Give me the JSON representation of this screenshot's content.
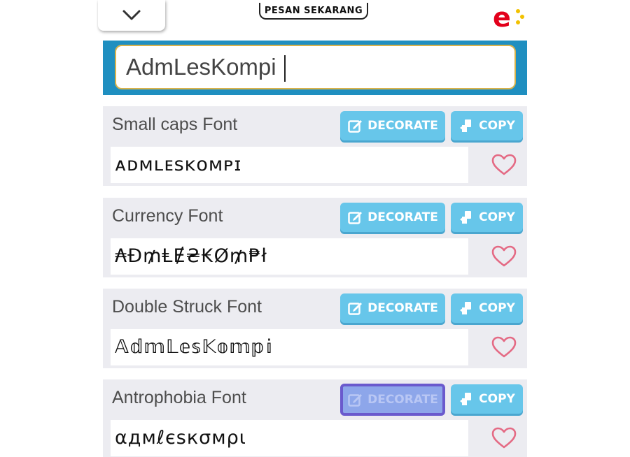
{
  "ad": {
    "button_label": "PESAN SEKARANG",
    "logo_icon": "brand-e-logo"
  },
  "input": {
    "value": "AdmLesKompi"
  },
  "fonts": [
    {
      "name": "Small caps Font",
      "output": "ᴀᴅᴍʟᴇsᴋᴏᴍᴘɪ",
      "decorate_label": "DECORATE",
      "copy_label": "COPY",
      "decorate_active": false
    },
    {
      "name": "Currency Font",
      "output": "₳Đ₥ⱠɆ₴₭Ø₥₱ł",
      "decorate_label": "DECORATE",
      "copy_label": "COPY",
      "decorate_active": false
    },
    {
      "name": "Double Struck Font",
      "output": "𝔸𝕕𝕞𝕃𝕖𝕤𝕂𝕠𝕞𝕡𝕚",
      "decorate_label": "DECORATE",
      "copy_label": "COPY",
      "decorate_active": false
    },
    {
      "name": "Antrophobia Font",
      "output": "αдмℓєѕкσмρι",
      "decorate_label": "DECORATE",
      "copy_label": "COPY",
      "decorate_active": true
    }
  ],
  "colors": {
    "panel_blue": "#1f8fc0",
    "button_blue": "#67c6ea",
    "heart_pink": "#e46a84",
    "card_bg": "#ececf1"
  }
}
